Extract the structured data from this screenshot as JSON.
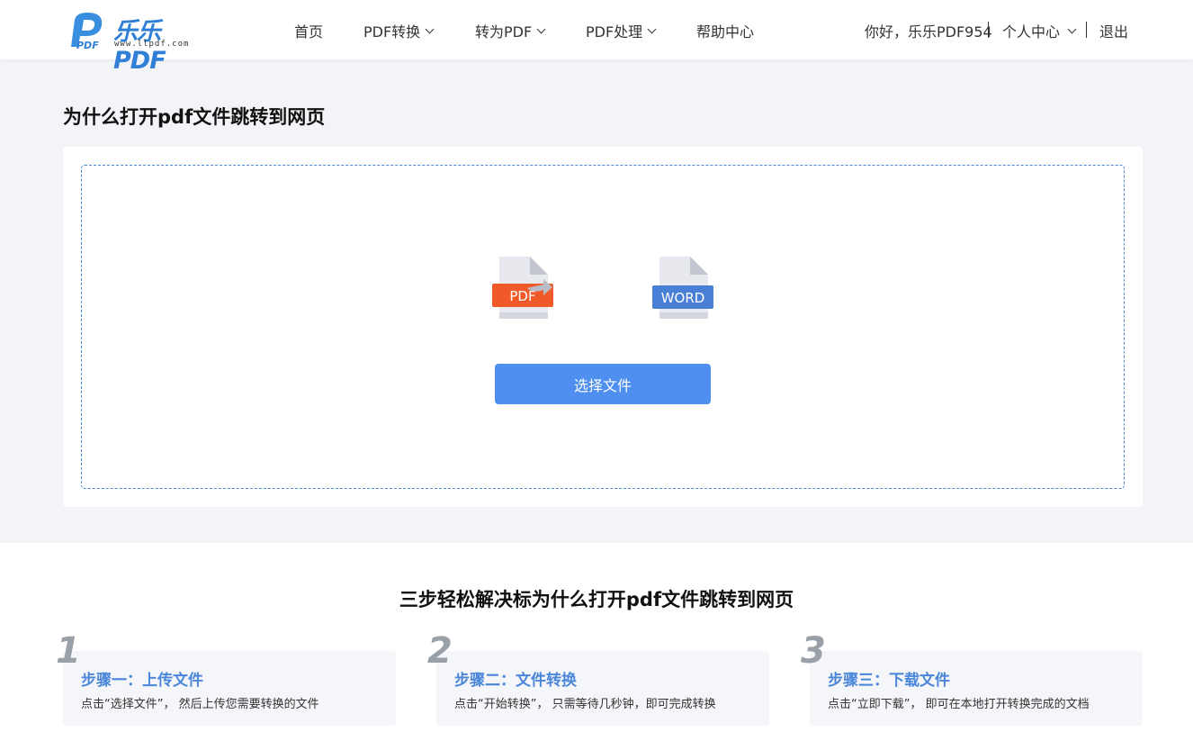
{
  "header": {
    "logo_text": "乐乐PDF",
    "logo_url": "www.llpdf.com",
    "nav": [
      {
        "label": "首页",
        "has_dropdown": false
      },
      {
        "label": "PDF转换",
        "has_dropdown": true
      },
      {
        "label": "转为PDF",
        "has_dropdown": true
      },
      {
        "label": "PDF处理",
        "has_dropdown": true
      },
      {
        "label": "帮助中心",
        "has_dropdown": false
      }
    ],
    "greeting": "你好，乐乐PDF954",
    "user_center": "个人中心",
    "logout": "退出"
  },
  "main": {
    "title": "为什么打开pdf文件跳转到网页",
    "source_format": "PDF",
    "target_format": "WORD",
    "select_button": "选择文件"
  },
  "steps": {
    "title": "三步轻松解决标为什么打开pdf文件跳转到网页",
    "items": [
      {
        "num": "1",
        "title": "步骤一：上传文件",
        "desc": "点击“选择文件”，  然后上传您需要转换的文件"
      },
      {
        "num": "2",
        "title": "步骤二：文件转换",
        "desc": "点击“开始转换”，  只需等待几秒钟，即可完成转换"
      },
      {
        "num": "3",
        "title": "步骤三：下载文件",
        "desc": "点击“立即下载”，  即可在本地打开转换完成的文档"
      }
    ]
  },
  "colors": {
    "brand_blue": "#2f7fd6",
    "button_blue": "#4e8ff0",
    "pdf_red": "#f05a28",
    "word_blue": "#4a7fd6"
  }
}
